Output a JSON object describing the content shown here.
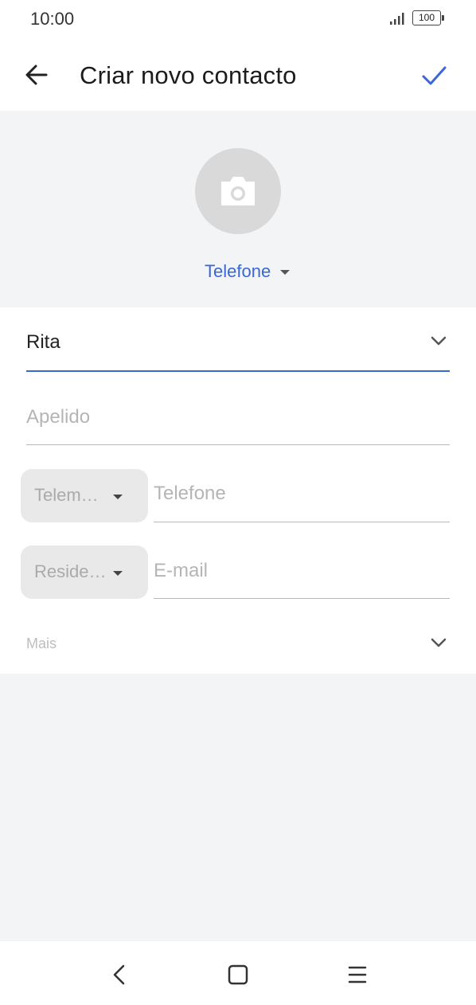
{
  "status_bar": {
    "time": "10:00",
    "battery": "100",
    "icons": [
      "signal-icon",
      "battery-icon"
    ]
  },
  "app_bar": {
    "title": "Criar novo contacto",
    "back_icon": "arrow-left-icon",
    "confirm_icon": "check-icon",
    "accent_color": "#3a67d6"
  },
  "photo": {
    "icon": "camera-icon",
    "account_label": "Telefone"
  },
  "form": {
    "first_name": {
      "value": "Rita"
    },
    "last_name": {
      "placeholder": "Apelido"
    },
    "phone": {
      "type_label": "Telem…",
      "placeholder": "Telefone"
    },
    "email": {
      "type_label": "Reside…",
      "placeholder": "E-mail"
    },
    "more_label": "Mais"
  },
  "nav_bar": {
    "icons": [
      "nav-back-icon",
      "nav-home-icon",
      "nav-menu-icon"
    ]
  }
}
